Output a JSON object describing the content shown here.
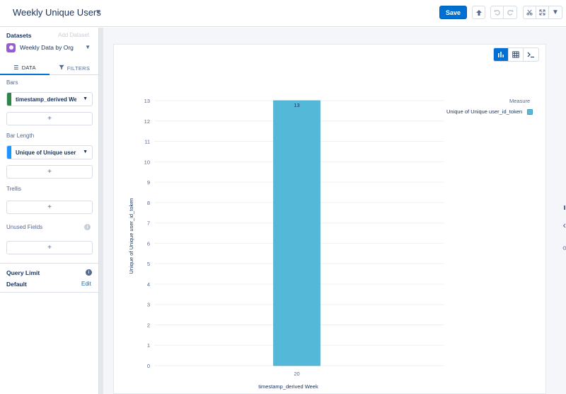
{
  "header": {
    "title": "Weekly Unique Users",
    "save_label": "Save"
  },
  "sidebar": {
    "datasets_label": "Datasets",
    "add_dataset_label": "Add Dataset",
    "dataset_name": "Weekly Data by Org",
    "tabs": [
      {
        "label": "DATA",
        "icon": "list-icon",
        "active": true
      },
      {
        "label": "FILTERS",
        "icon": "filter-icon",
        "active": false
      }
    ],
    "bars_label": "Bars",
    "bars_field": "timestamp_derived We",
    "bars_color": "#2e844a",
    "bar_length_label": "Bar Length",
    "bar_length_field": "Unique of Unique user_",
    "bar_length_color": "#1b96ff",
    "trellis_label": "Trellis",
    "unused_fields_label": "Unused Fields",
    "add_symbol": "+",
    "info_symbol": "i",
    "query_limit_label": "Query Limit",
    "query_limit_value": "Default",
    "edit_label": "Edit"
  },
  "legend": {
    "title": "Measure",
    "items": [
      "Unique of Unique user_id_token"
    ]
  },
  "chart_data": {
    "type": "bar",
    "categories": [
      "20"
    ],
    "series": [
      {
        "name": "Unique of Unique user_id_token",
        "values": [
          13
        ]
      }
    ],
    "xlabel": "timestamp_derived Week",
    "ylabel": "Unique of Unique user_id_token",
    "ylim": [
      0,
      13
    ],
    "yticks": [
      0,
      1,
      2,
      3,
      4,
      5,
      6,
      7,
      8,
      9,
      10,
      11,
      12,
      13
    ],
    "data_labels": [
      "13"
    ],
    "grid": true,
    "legend_position": "top-right",
    "bar_color": "#54b8d9"
  }
}
